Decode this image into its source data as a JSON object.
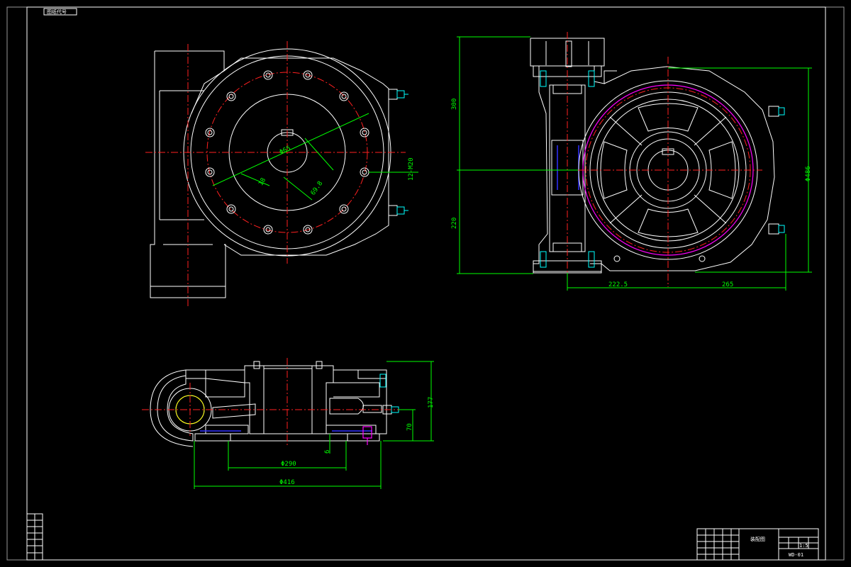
{
  "drawing": {
    "corner_label": "图纸代号",
    "front_view": {
      "dim_bore": "Φ65",
      "dim_key": "18",
      "dim_keydepth": "69.8",
      "dim_holes": "12-M20"
    },
    "side_view": {
      "dim_upper": "300",
      "dim_lower": "220",
      "dim_left": "222.5",
      "dim_right": "265",
      "dim_dia": "Φ486"
    },
    "section_view": {
      "dim_height": "177",
      "dim_flange": "70",
      "dim_small": "6",
      "dim_inner": "Φ290",
      "dim_outer": "Φ416"
    },
    "title_block": {
      "name": "装配图",
      "code": "WD-01",
      "scale": "1:5"
    }
  },
  "colors": {
    "background": "#000000",
    "outline": "#ffffff",
    "centerline": "#ff2020",
    "dimension": "#00ff00",
    "bolt": "#00ffff",
    "gear": "#ff00ff",
    "seal": "#3030ff",
    "hatch": "#ffff00"
  }
}
